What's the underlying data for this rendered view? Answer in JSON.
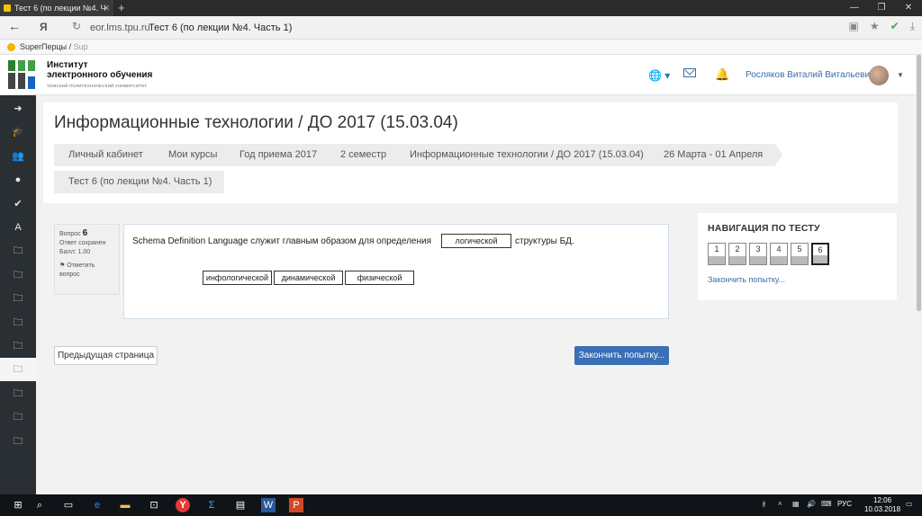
{
  "browser": {
    "tab_title": "Тест 6 (по лекции №4. Ч",
    "tab_close": "✕",
    "new_tab": "+",
    "win_controls": [
      "—",
      "❐",
      "✕"
    ],
    "yandex_logo": "Я",
    "domain": "eor.lms.tpu.ru",
    "page_title": "Тест 6 (по лекции №4. Часть 1)",
    "bookmark_label": "SuperПерцы /",
    "bookmark_label_muted": "Sup"
  },
  "site": {
    "logo_line1": "Институт",
    "logo_line2": "электронного обучения",
    "logo_sub": "ТОМСКИЙ ПОЛИТЕХНИЧЕСКИЙ УНИВЕРСИТЕТ",
    "logo_colors": [
      "#2e7d32",
      "#43a047",
      "#1565c0",
      "#444444"
    ],
    "user_name": "Росляков Виталий Витальевич"
  },
  "sidebar": {
    "icons": [
      {
        "name": "arrow-right-circle-icon",
        "glyph": "➜"
      },
      {
        "name": "graduation-cap-icon",
        "glyph": "🎓"
      },
      {
        "name": "users-icon",
        "glyph": "👥"
      },
      {
        "name": "circle-icon",
        "glyph": "●"
      },
      {
        "name": "check-circle-icon",
        "glyph": "✔"
      },
      {
        "name": "font-icon",
        "glyph": "A"
      },
      {
        "name": "folder-icon",
        "glyph": "🗀"
      },
      {
        "name": "folder-icon",
        "glyph": "🗀"
      },
      {
        "name": "folder-icon",
        "glyph": "🗀"
      },
      {
        "name": "folder-icon",
        "glyph": "🗀"
      },
      {
        "name": "folder-icon",
        "glyph": "🗀"
      },
      {
        "name": "folder-icon-active",
        "glyph": "🗀"
      },
      {
        "name": "folder-icon",
        "glyph": "🗀"
      },
      {
        "name": "folder-icon",
        "glyph": "🗀"
      },
      {
        "name": "folder-icon",
        "glyph": "🗀"
      }
    ]
  },
  "course": {
    "title": "Информационные технологии / ДО 2017 (15.03.04)",
    "breadcrumbs": [
      "Личный кабинет",
      "Мои курсы",
      "Год приема 2017",
      "2 семестр",
      "Информационные технологии / ДО 2017 (15.03.04)",
      "26 Марта - 01 Апреля"
    ],
    "breadcrumb_last": "Тест 6 (по лекции №4. Часть 1)"
  },
  "question": {
    "label": "Вопрос",
    "number": "6",
    "status": "Ответ сохранен",
    "score": "Балл: 1.00",
    "flag_label": "Отметить вопрос",
    "text_before": "Schema Definition Language служит главным образом для определения",
    "text_after": "структуры БД.",
    "dropped_answer": "логической",
    "options": [
      "инфологической",
      "динамической",
      "физической"
    ]
  },
  "actions": {
    "prev_page": "Предыдущая страница",
    "finish": "Закончить попытку..."
  },
  "quiz_nav": {
    "title": "НАВИГАЦИЯ ПО ТЕСТУ",
    "buttons": [
      "1",
      "2",
      "3",
      "4",
      "5",
      "6"
    ],
    "current": "6",
    "finish_link": "Закончить попытку..."
  },
  "taskbar": {
    "lang": "РУС",
    "time": "12:06",
    "date": "10.03.2018"
  }
}
